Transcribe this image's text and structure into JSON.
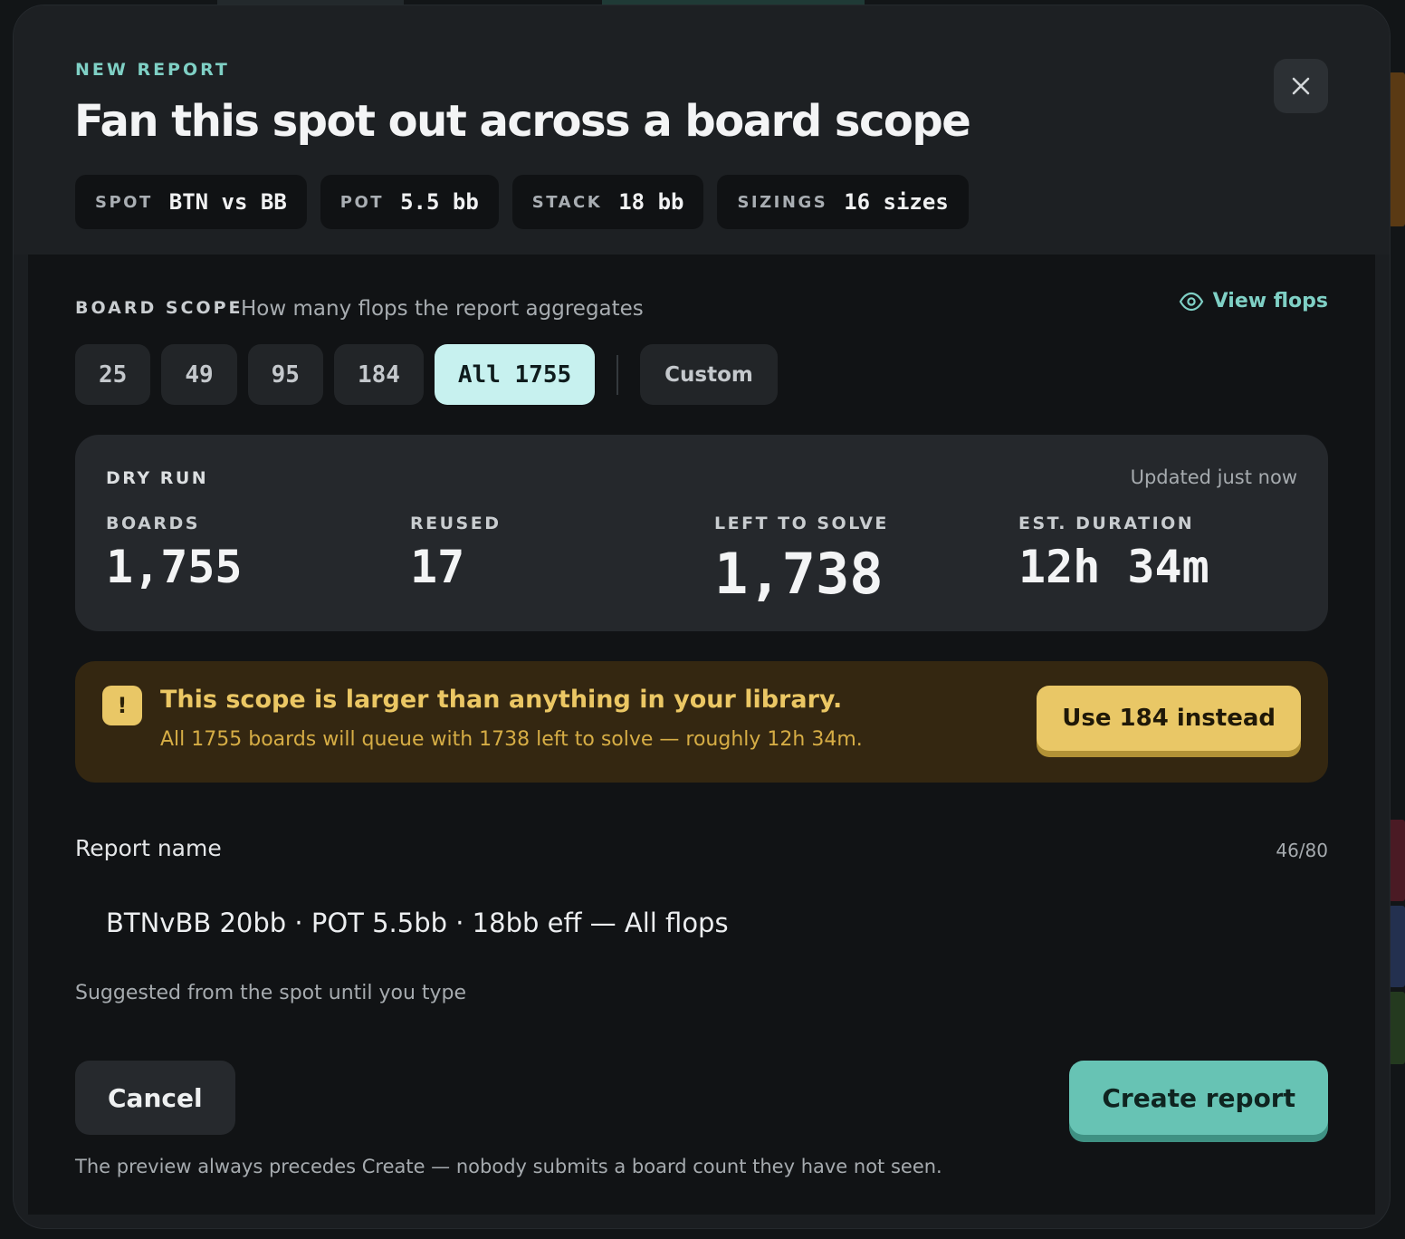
{
  "header": {
    "eyebrow": "NEW REPORT",
    "title": "Fan this spot out across a board scope",
    "chips": [
      {
        "key": "SPOT",
        "value": "BTN vs BB"
      },
      {
        "key": "POT",
        "value": "5.5 bb"
      },
      {
        "key": "STACK",
        "value": "18 bb"
      },
      {
        "key": "SIZINGS",
        "value": "16 sizes"
      }
    ],
    "close_icon": "close-icon"
  },
  "scope": {
    "label": "BOARD SCOPE",
    "description": "How many flops the report aggregates",
    "view_flops": "View flops",
    "view_icon": "eye-icon",
    "options": [
      "25",
      "49",
      "95",
      "184",
      "All 1755"
    ],
    "selected": "All 1755",
    "custom": "Custom"
  },
  "dry_run": {
    "title": "DRY RUN",
    "updated": "Updated just now",
    "stats": [
      {
        "label": "BOARDS",
        "value": "1,755"
      },
      {
        "label": "REUSED",
        "value": "17"
      },
      {
        "label": "LEFT TO SOLVE",
        "value": "1,738"
      },
      {
        "label": "EST. DURATION",
        "value": "12h 34m"
      }
    ]
  },
  "warning": {
    "icon": "!",
    "title": "This scope is larger than anything in your library.",
    "detail": "All 1755 boards will queue with 1738 left to solve — roughly 12h 34m.",
    "action": "Use 184 instead"
  },
  "report_name": {
    "label": "Report name",
    "count": "46/80",
    "value": "BTNvBB 20bb · POT 5.5bb · 18bb eff — All flops",
    "hint": "Suggested from the spot until you type"
  },
  "footer": {
    "cancel": "Cancel",
    "create": "Create report",
    "note": "The preview always precedes Create — nobody submits a board count they have not seen."
  },
  "colors": {
    "accent": "#7fd0c5",
    "selected_scope": "#c7f1ef",
    "warning_bg": "#342711",
    "warning_accent": "#e9c766",
    "create_button": "#67c3b4"
  }
}
